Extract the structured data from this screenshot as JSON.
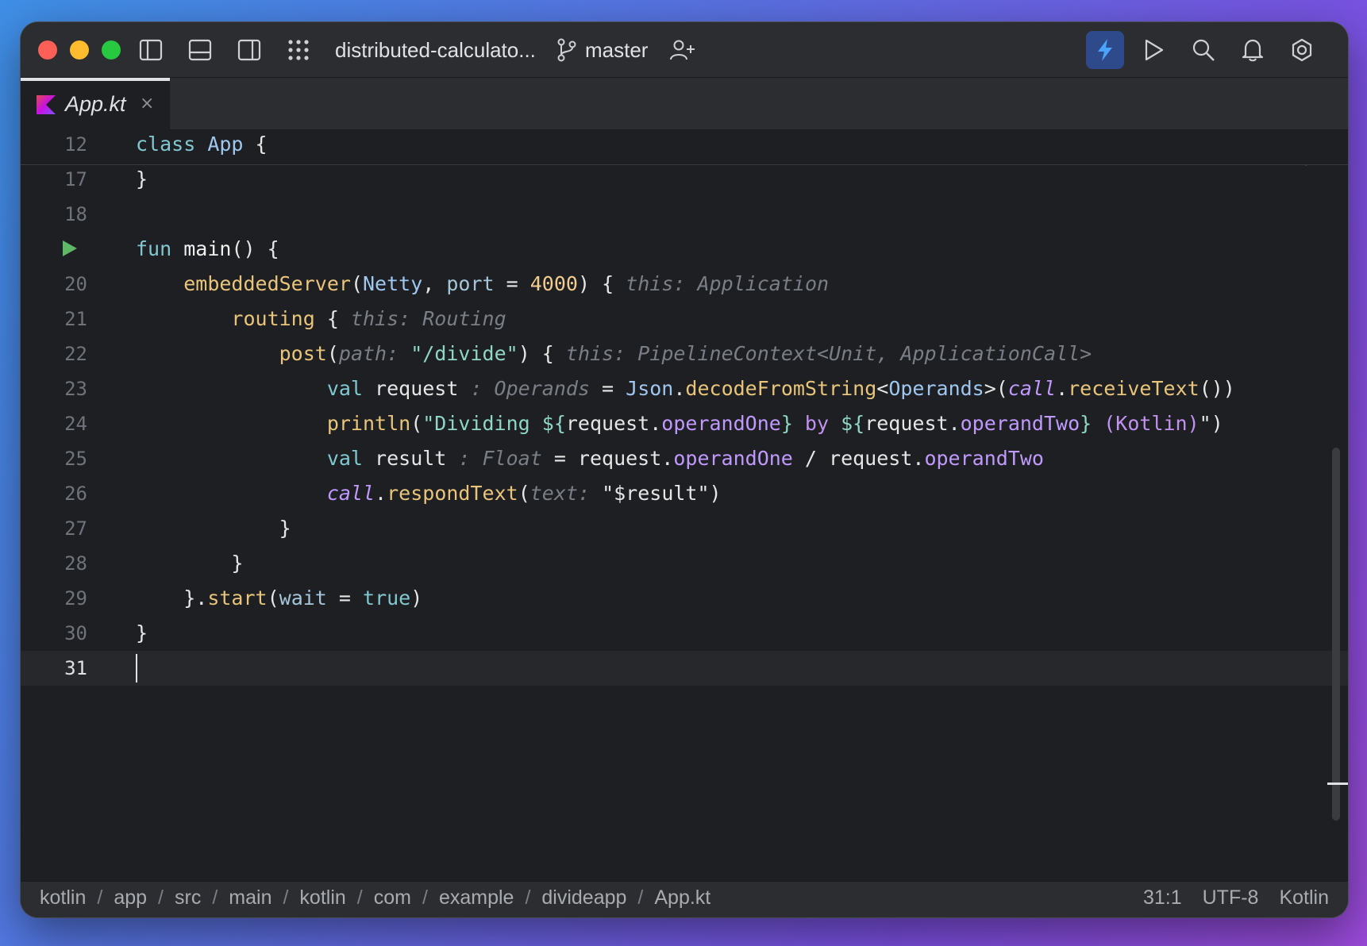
{
  "window": {
    "project_name": "distributed-calculato...",
    "branch": "master"
  },
  "tab": {
    "label": "App.kt",
    "close": "×"
  },
  "icons": {
    "sidebar_left": "sidebar-left-icon",
    "panel_bottom": "panel-bottom-icon",
    "sidebar_right": "sidebar-right-icon",
    "apps_grid": "grid-icon",
    "branch": "git-branch-icon",
    "add_user": "add-user-icon",
    "ai": "bolt-icon",
    "run": "play-icon",
    "search": "search-icon",
    "notifications": "bell-icon",
    "settings": "gear-icon",
    "kotlin": "kotlin-icon",
    "ok": "checkmark-icon"
  },
  "colors": {
    "accent": "#2f4a8a",
    "run_green": "#5fb865",
    "traffic_red": "#fe5f57",
    "traffic_yellow": "#febc2e",
    "traffic_green": "#28c840"
  },
  "editor": {
    "line_numbers": {
      "l12": "12",
      "l17": "17",
      "l18": "18",
      "l20": "20",
      "l21": "21",
      "l22": "22",
      "l23": "23",
      "l24": "24",
      "l25": "25",
      "l26": "26",
      "l27": "27",
      "l28": "28",
      "l29": "29",
      "l30": "30",
      "l31": "31"
    },
    "code": {
      "l12": {
        "kw": "class",
        "name": "App",
        "brace": "{"
      },
      "l17": {
        "brace": "}"
      },
      "l19": {
        "kw": "fun",
        "name": "main",
        "rest": "() {"
      },
      "l20": {
        "fn": "embeddedServer",
        "open": "(",
        "cls": "Netty",
        "comma": ", ",
        "param": "port",
        "eq": " = ",
        "num": "4000",
        "close": ") {",
        "hint": "this: Application"
      },
      "l21": {
        "fn": "routing",
        "open": " {",
        "hint": "this: Routing"
      },
      "l22": {
        "fn": "post",
        "open": "(",
        "hint_param": "path: ",
        "str": "\"/divide\"",
        "close": ") {",
        "hint": "this: PipelineContext<Unit, ApplicationCall>"
      },
      "l23": {
        "kw": "val",
        "name": " request",
        "hint": " : Operands",
        "eq": " = ",
        "cls": "Json",
        "dot": ".",
        "fn": "decodeFromString",
        "lt": "<",
        "cls2": "Operands",
        "gt": ">(",
        "ital": "call",
        "dot2": ".",
        "fn2": "receiveText",
        "close": "())"
      },
      "l24": {
        "fn": "println",
        "open": "(",
        "str1": "\"Dividing ",
        "t1": "${",
        "v1": "request",
        "dot1": ".",
        "p1": "operandOne",
        "t1c": "}",
        "str2": " by ",
        "t2": "${",
        "v2": "request",
        "dot2": ".",
        "p2": "operandTwo",
        "t2c": "}",
        "str3": " (Kotlin)",
        "str4": "\"",
        "close": ")"
      },
      "l25": {
        "kw": "val",
        "name": " result",
        "hint": " : Float",
        "eq": " = ",
        "v1": "request",
        "dot1": ".",
        "p1": "operandOne",
        "op": " / ",
        "v2": "request",
        "dot2": ".",
        "p2": "operandTwo"
      },
      "l26": {
        "ital": "call",
        "dot": ".",
        "fn": "respondText",
        "open": "(",
        "hint_param": "text: ",
        "str1": "\"",
        "tmpl": "$result",
        "str2": "\"",
        "close": ")"
      },
      "l27": {
        "brace": "}"
      },
      "l28": {
        "brace": "}"
      },
      "l29": {
        "brace": "}.",
        "fn": "start",
        "open": "(",
        "param": "wait",
        "eq": " = ",
        "kw": "true",
        "close": ")"
      },
      "l30": {
        "brace": "}"
      }
    }
  },
  "statusbar": {
    "breadcrumb": [
      "kotlin",
      "app",
      "src",
      "main",
      "kotlin",
      "com",
      "example",
      "divideapp",
      "App.kt"
    ],
    "separator": "/",
    "position": "31:1",
    "encoding": "UTF-8",
    "language": "Kotlin"
  }
}
